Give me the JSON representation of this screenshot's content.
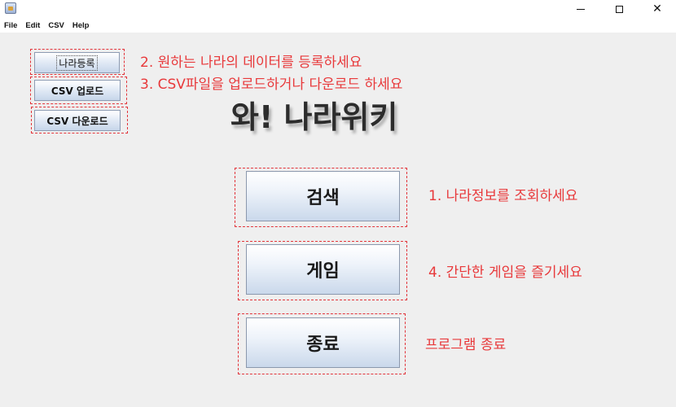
{
  "window": {
    "minimize_label": "",
    "maximize_label": "",
    "close_label": "✕"
  },
  "menu": [
    "File",
    "Edit",
    "CSV",
    "Help"
  ],
  "side_buttons": {
    "register": "나라등록",
    "csv_upload": "CSV 업로드",
    "csv_download": "CSV 다운로드"
  },
  "title": "와! 나라위키",
  "main_buttons": {
    "search": "검색",
    "game": "게임",
    "exit": "종료"
  },
  "hints": {
    "register": "2. 원하는 나라의 데이터를 등록하세요",
    "csv": "3. CSV파일을 업로드하거나 다운로드 하세요",
    "search": "1. 나라정보를 조회하세요",
    "game": "4. 간단한 게임을 즐기세요",
    "exit": "프로그램 종료"
  },
  "colors": {
    "hint_text": "#e8393b",
    "dashed_border": "#e2343a"
  }
}
